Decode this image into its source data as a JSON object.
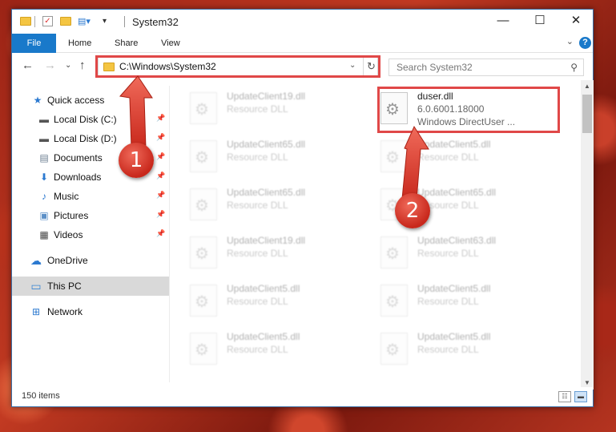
{
  "window": {
    "title": "System32",
    "minimize": "—",
    "maximize": "☐",
    "close": "✕"
  },
  "ribbon": {
    "tabs": [
      "File",
      "Home",
      "Share",
      "View"
    ],
    "help": "?",
    "collapse": "⌄"
  },
  "nav": {
    "back": "←",
    "forward": "→",
    "recent": "⌄",
    "up": "↑",
    "address": "C:\\Windows\\System32",
    "address_dropdown": "⌄",
    "refresh": "↻",
    "search_placeholder": "Search System32",
    "search_icon": "⚲"
  },
  "sidebar": {
    "items": [
      {
        "label": "Quick access",
        "icon": "star-icon",
        "glyph": "★",
        "color": "#2b79d0",
        "pinned": false
      },
      {
        "label": "Local Disk (C:)",
        "icon": "drive-icon",
        "glyph": "▬",
        "color": "#555555",
        "pinned": true
      },
      {
        "label": "Local Disk (D:)",
        "icon": "drive-icon",
        "glyph": "▬",
        "color": "#555555",
        "pinned": true
      },
      {
        "label": "Documents",
        "icon": "documents-icon",
        "glyph": "▤",
        "color": "#6a7d90",
        "pinned": true
      },
      {
        "label": "Downloads",
        "icon": "download-icon",
        "glyph": "⬇",
        "color": "#2b79d0",
        "pinned": true
      },
      {
        "label": "Music",
        "icon": "music-icon",
        "glyph": "♪",
        "color": "#2b79d0",
        "pinned": true
      },
      {
        "label": "Pictures",
        "icon": "pictures-icon",
        "glyph": "▣",
        "color": "#5b8fc7",
        "pinned": true
      },
      {
        "label": "Videos",
        "icon": "videos-icon",
        "glyph": "▦",
        "color": "#444444",
        "pinned": true
      },
      {
        "label": "OneDrive",
        "icon": "onedrive-icon",
        "glyph": "☁",
        "color": "#2b79d0",
        "pinned": false
      },
      {
        "label": "This PC",
        "icon": "computer-icon",
        "glyph": "▭",
        "color": "#3a86d4",
        "pinned": false,
        "selected": true
      },
      {
        "label": "Network",
        "icon": "network-icon",
        "glyph": "⊞",
        "color": "#2b79d0",
        "pinned": false
      }
    ],
    "pin_glyph": "📌"
  },
  "files": {
    "left_column": [
      {
        "name": "UpdateClient19.dll",
        "desc": "Resource DLL"
      },
      {
        "name": "UpdateClient65.dll",
        "desc": "Resource DLL"
      },
      {
        "name": "UpdateClient65.dll",
        "desc": "Resource DLL"
      },
      {
        "name": "UpdateClient19.dll",
        "desc": "Resource DLL"
      },
      {
        "name": "UpdateClient5.dll",
        "desc": "Resource DLL"
      },
      {
        "name": "UpdateClient5.dll",
        "desc": "Resource DLL"
      }
    ],
    "right_column": [
      {
        "name": "duser.dll",
        "desc": "6.0.6001.18000",
        "extra": "Windows DirectUser ...",
        "highlighted": true
      },
      {
        "name": "UpdateClient5.dll",
        "desc": "Resource DLL"
      },
      {
        "name": "UpdateClient65.dll",
        "desc": "Resource DLL"
      },
      {
        "name": "UpdateClient63.dll",
        "desc": "Resource DLL"
      },
      {
        "name": "UpdateClient5.dll",
        "desc": "Resource DLL"
      },
      {
        "name": "UpdateClient5.dll",
        "desc": "Resource DLL"
      }
    ]
  },
  "status": {
    "item_count": "150 items"
  },
  "callouts": [
    "1",
    "2"
  ],
  "colors": {
    "accent": "#1979ca",
    "highlight": "#e04848",
    "callout": "#c8281c"
  }
}
